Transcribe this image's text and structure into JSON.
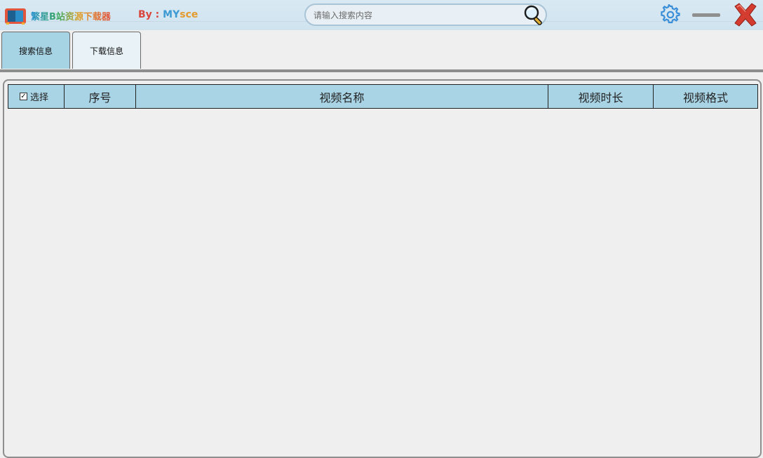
{
  "app": {
    "title": "繁星B站资源下载器",
    "author_prefix": "By : ",
    "author_name_a": "MY",
    "author_name_b": "sce"
  },
  "search": {
    "placeholder": "请输入搜索内容",
    "value": ""
  },
  "icons": {
    "search": "search-icon",
    "settings": "gear-icon",
    "minimize": "minimize-icon",
    "close": "close-icon",
    "logo": "app-logo-icon"
  },
  "tabs": [
    {
      "label": "搜索信息",
      "active": true
    },
    {
      "label": "下载信息",
      "active": false
    }
  ],
  "table": {
    "select_label": "选择",
    "select_checked": true,
    "columns": [
      "序号",
      "视频名称",
      "视频时长",
      "视频格式"
    ],
    "rows": []
  },
  "colors": {
    "header_bg": "#a9d4e5",
    "tab_active": "#a7d4e4",
    "close_red": "#d43c2f",
    "gear_blue": "#3b8fd8"
  }
}
